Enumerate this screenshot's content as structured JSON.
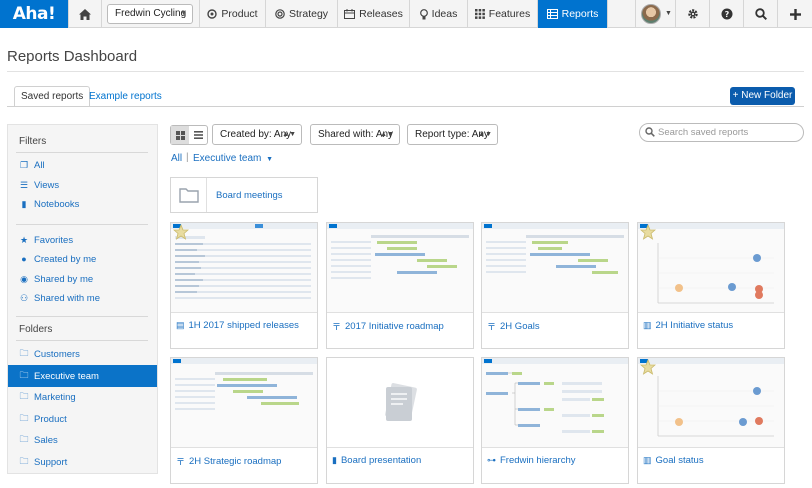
{
  "nav": {
    "logo": "Aha!",
    "workspace": "Fredwin Cycling",
    "items": [
      {
        "label": "Product",
        "icon": "product-icon"
      },
      {
        "label": "Strategy",
        "icon": "strategy-icon"
      },
      {
        "label": "Releases",
        "icon": "releases-icon"
      },
      {
        "label": "Ideas",
        "icon": "ideas-icon"
      },
      {
        "label": "Features",
        "icon": "features-icon"
      },
      {
        "label": "Reports",
        "icon": "reports-icon",
        "active": true
      }
    ],
    "icons": [
      "home-icon",
      "gear-icon",
      "help-icon",
      "search-icon",
      "plus-icon"
    ],
    "accent": "#0073cf"
  },
  "page": {
    "title": "Reports Dashboard",
    "tabs": [
      "Saved reports",
      "Example reports"
    ],
    "new_folder": "+ New Folder"
  },
  "sidebar": {
    "filters_heading": "Filters",
    "filters": [
      {
        "label": "All",
        "icon": "copy-icon"
      },
      {
        "label": "Views",
        "icon": "list-icon"
      },
      {
        "label": "Notebooks",
        "icon": "book-icon"
      },
      {
        "label": "Favorites",
        "icon": "star-icon"
      },
      {
        "label": "Created by me",
        "icon": "user-icon"
      },
      {
        "label": "Shared by me",
        "icon": "share-icon"
      },
      {
        "label": "Shared with me",
        "icon": "users-icon"
      }
    ],
    "folders_heading": "Folders",
    "folders": [
      {
        "label": "Customers",
        "active": false
      },
      {
        "label": "Executive team",
        "active": true
      },
      {
        "label": "Marketing",
        "active": false
      },
      {
        "label": "Product",
        "active": false
      },
      {
        "label": "Sales",
        "active": false
      },
      {
        "label": "Support",
        "active": false
      }
    ]
  },
  "toolbar": {
    "created_by": "Created by: Any",
    "shared_with": "Shared with: Any",
    "report_type": "Report type: Any",
    "search_placeholder": "Search saved reports"
  },
  "breadcrumb": {
    "all": "All",
    "current": "Executive team"
  },
  "folders": [
    {
      "label": "Board meetings"
    }
  ],
  "reports": [
    {
      "label": "1H 2017 shipped releases",
      "icon": "table-icon",
      "thumb": "list",
      "favorite": true
    },
    {
      "label": "2017 Initiative roadmap",
      "icon": "roadmap-icon",
      "thumb": "gantt",
      "favorite": false
    },
    {
      "label": "2H Goals",
      "icon": "roadmap-icon",
      "thumb": "gantt",
      "favorite": false
    },
    {
      "label": "2H Initiative status",
      "icon": "chart-icon",
      "thumb": "scatter",
      "favorite": true
    },
    {
      "label": "2H Strategic roadmap",
      "icon": "roadmap-icon",
      "thumb": "gantt",
      "favorite": false
    },
    {
      "label": "Board presentation",
      "icon": "notebook-icon",
      "thumb": "notebook",
      "favorite": false
    },
    {
      "label": "Fredwin hierarchy",
      "icon": "hierarchy-icon",
      "thumb": "hierarchy",
      "favorite": false
    },
    {
      "label": "Goal status",
      "icon": "chart-icon",
      "thumb": "scatter",
      "favorite": true
    }
  ]
}
